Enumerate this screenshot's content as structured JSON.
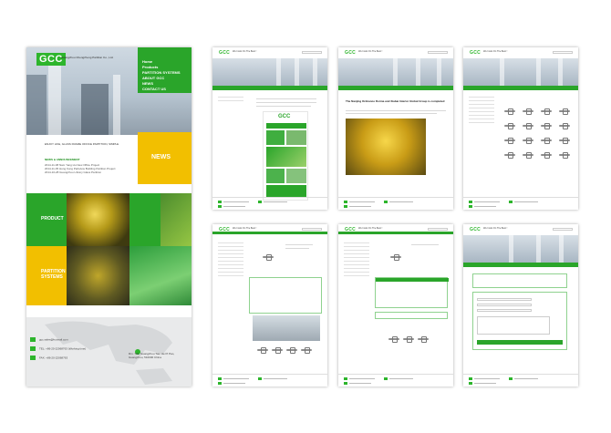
{
  "home": {
    "logo": "GCC",
    "tagline": "Guangzhou Chengzheng Partition Co., Ltd.",
    "menu": [
      "Home",
      "Products",
      "PARTITION SYSTEMS",
      "ABOUT GCC",
      "NEWS",
      "CONTACT US"
    ],
    "photo_caption": "ENJOY LIFE, GLASS FRAME OFFICE PARTITION, SIMPLE",
    "news_label": "NEWS",
    "news_heading": "NEWS & ANNOUNCEMENT",
    "news_items": [
      "2014-11-08  Nam Yang Hu New Office Project",
      "2014-11-05  Hong Kong Parkview Building Partition Project",
      "2014-10-28  Guangzhou Library Glass Partition"
    ],
    "product_label": "PRODUCT",
    "partition_label": "PARTITION SYSTEMS",
    "contact_label": "CONTACT US",
    "footer": [
      "gcc.sales@hotmail.com",
      "TEL: +86-20-22068763 (Working time)",
      "FAX: +86-20-22068763"
    ],
    "address": "Rm. 702, Guangzhou Tian He Pi Pao, Guangzhou, 510000 China"
  },
  "inner_logo": "GCC",
  "inner_tagline": "We Insist On The Best !",
  "article_title": "The Nanjing Ordnance Dorma and Xiabai Interior Global Group is completed",
  "brochure_logo": "GCC",
  "colors": {
    "brand_green": "#2aa52a",
    "accent_yellow": "#f2bf00"
  }
}
